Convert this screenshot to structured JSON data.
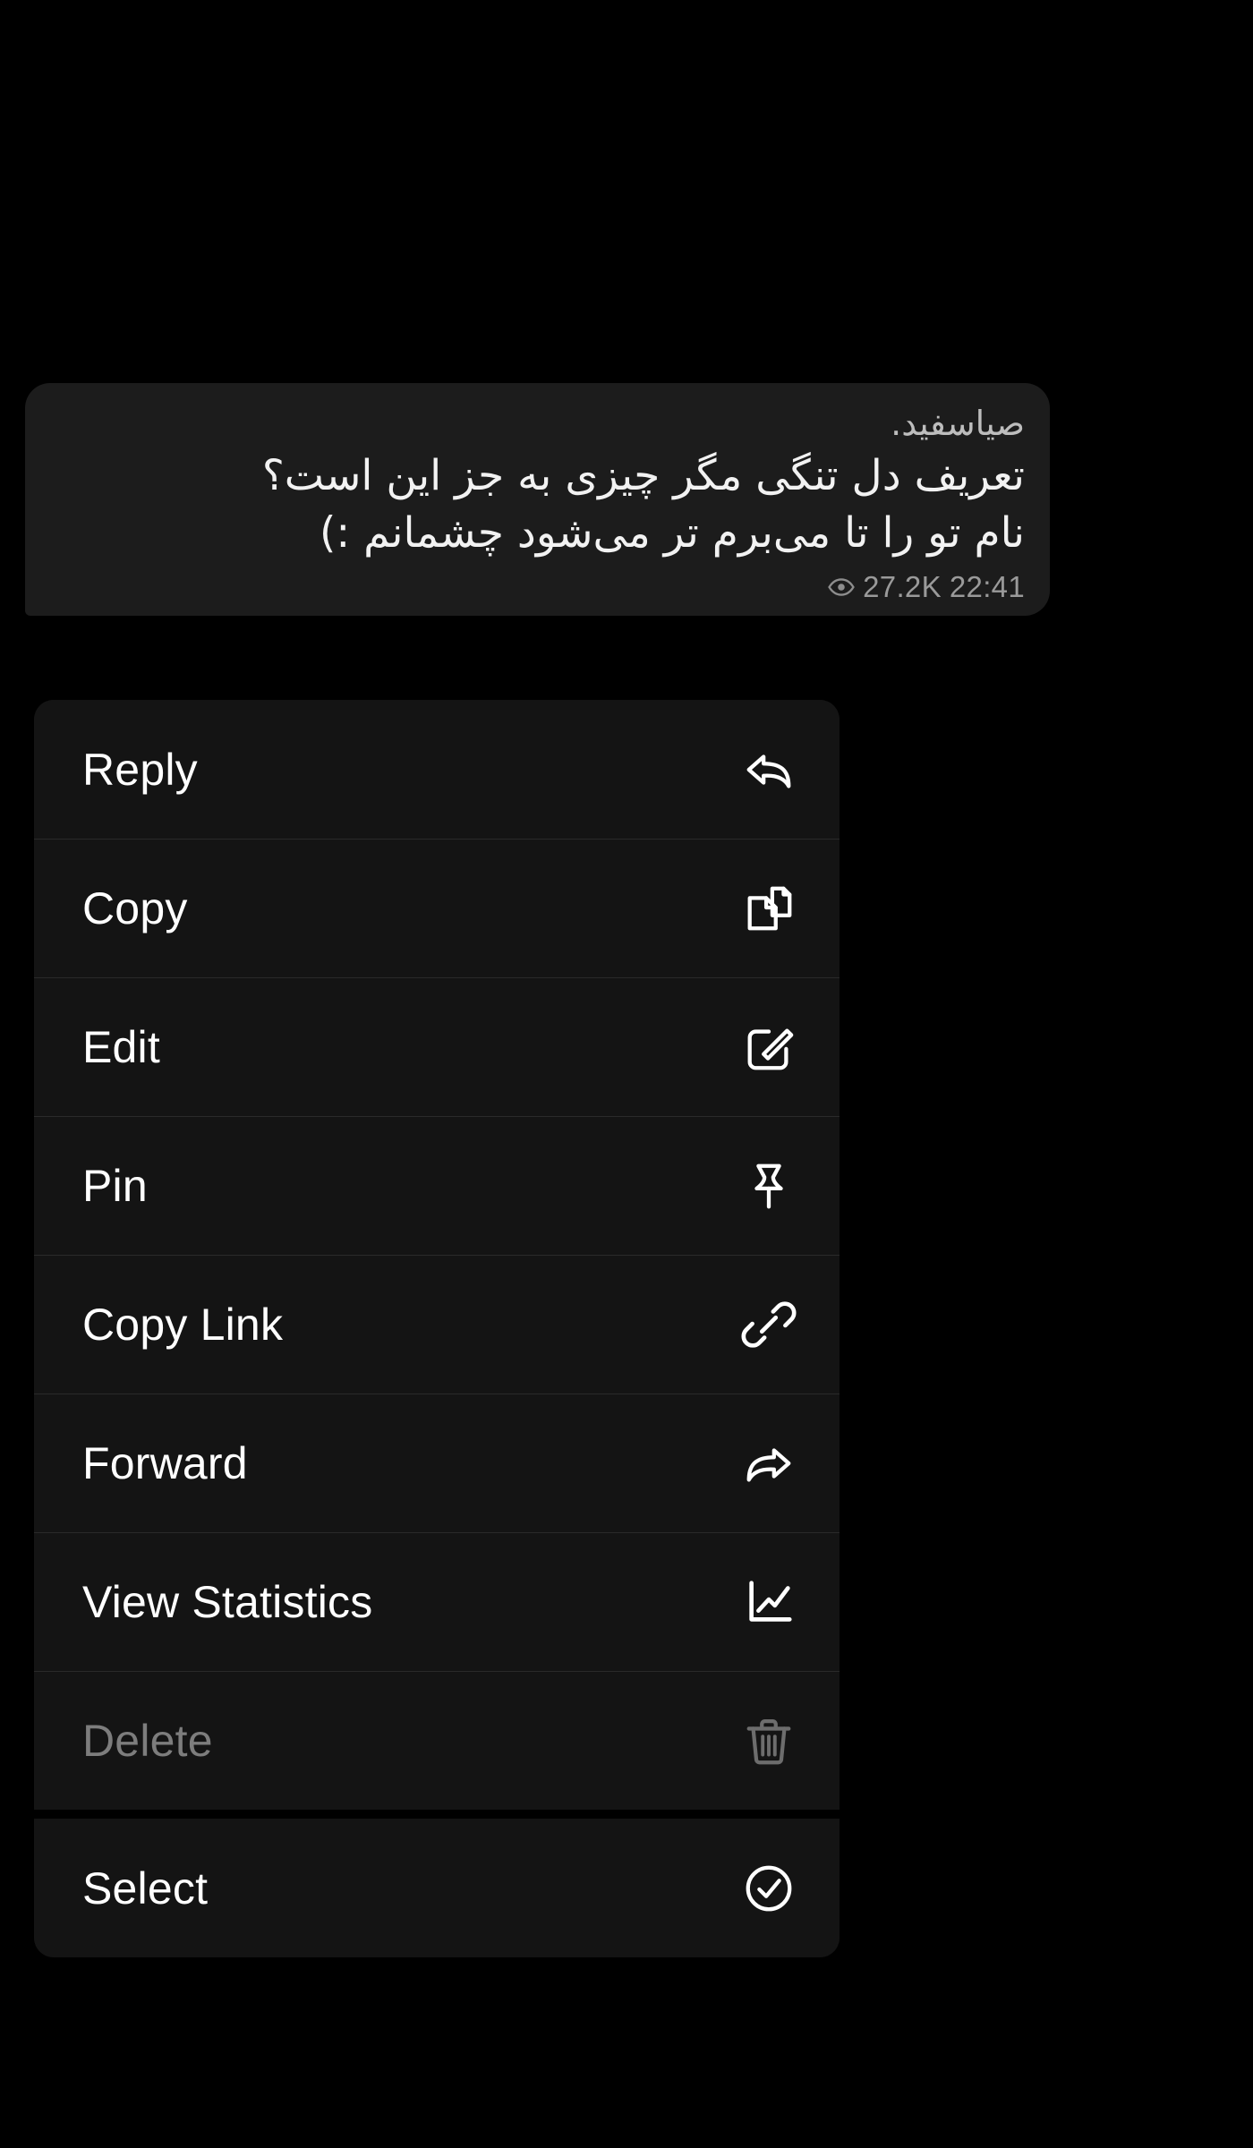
{
  "app": {
    "theme": "dark",
    "background_color": "#000000",
    "bubble_color": "#1c1c1c",
    "menu_color": "#141414",
    "text_color": "#ffffff",
    "muted_text_color": "#9a9a9a",
    "disabled_text_color": "#7d7d7d"
  },
  "message": {
    "signature": "صیاسفید.",
    "body": "تعریف دل تنگی مگر چیزی به جز این است؟\nنام تو را تا می‌برم تر می‌شود چشمانم :)",
    "views_icon": "eye-icon",
    "views": "27.2K",
    "time": "22:41"
  },
  "context_menu": {
    "groups": [
      {
        "items": [
          {
            "label": "Reply",
            "icon": "reply-icon",
            "disabled": false
          },
          {
            "label": "Copy",
            "icon": "copy-icon",
            "disabled": false
          },
          {
            "label": "Edit",
            "icon": "edit-icon",
            "disabled": false
          },
          {
            "label": "Pin",
            "icon": "pin-icon",
            "disabled": false
          },
          {
            "label": "Copy Link",
            "icon": "link-icon",
            "disabled": false
          },
          {
            "label": "Forward",
            "icon": "forward-icon",
            "disabled": false
          },
          {
            "label": "View Statistics",
            "icon": "chart-icon",
            "disabled": false
          },
          {
            "label": "Delete",
            "icon": "trash-icon",
            "disabled": true
          }
        ]
      },
      {
        "items": [
          {
            "label": "Select",
            "icon": "check-circle-icon",
            "disabled": false
          }
        ]
      }
    ]
  }
}
